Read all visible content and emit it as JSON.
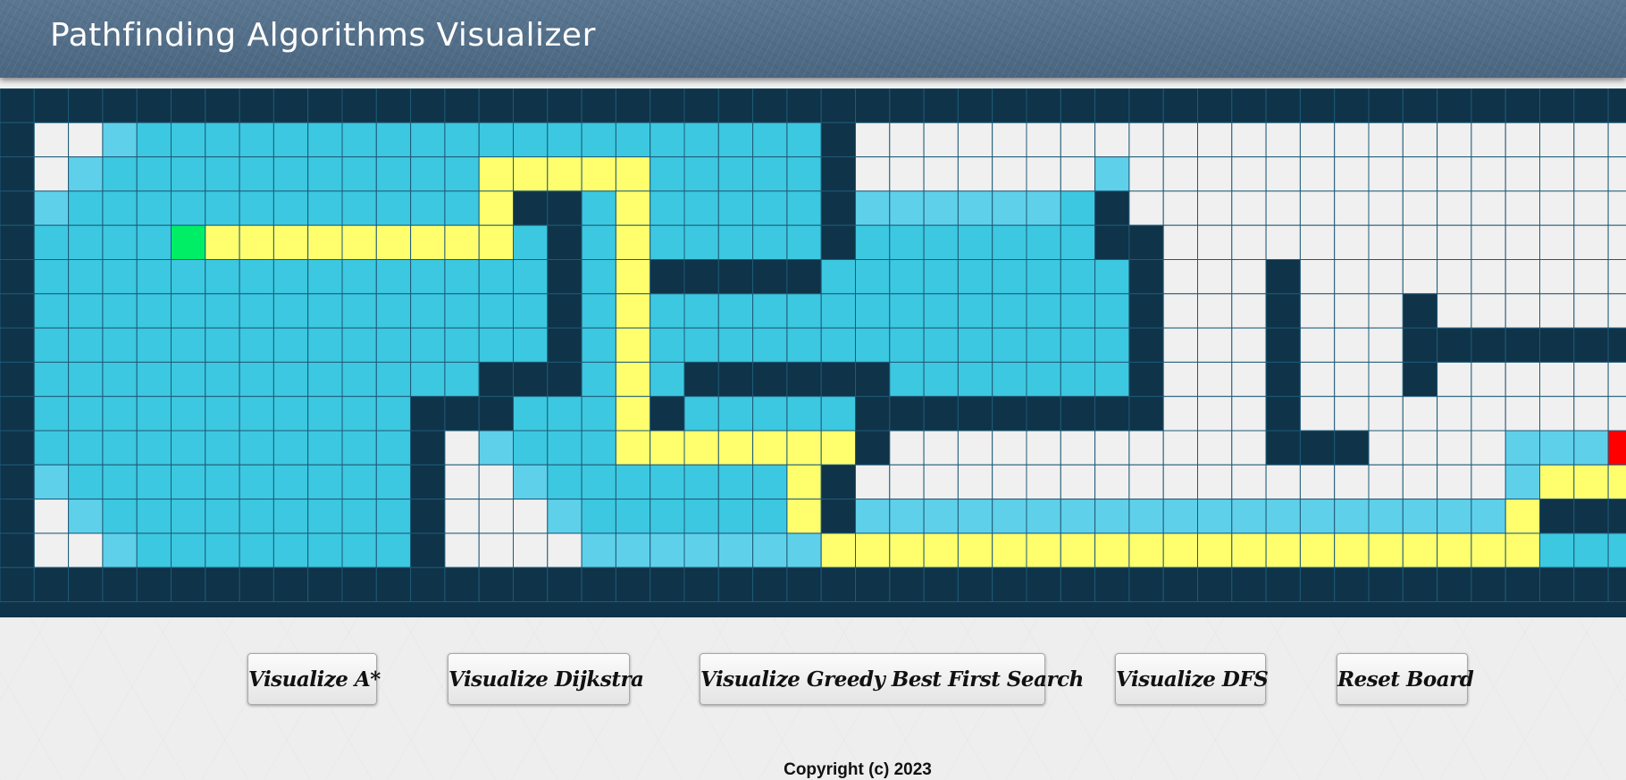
{
  "header": {
    "title": "Pathfinding Algorithms Visualizer"
  },
  "grid": {
    "rows": 15,
    "cols": 48,
    "colors": {
      "wall": "#0f3348",
      "empty": "#f0f0f0",
      "visited": "#3cc8e0",
      "visited_light": "#5fd0ea",
      "path": "#ffff6e",
      "start": "#00ee66",
      "end": "#ff0000",
      "grid_line": "#1e5a78"
    },
    "cells": [
      "WWWWWWWWWWWWWWWWWWWWWWWWWWWWWWWWWWWWWWWWWWWWWWWWWW",
      "W..LVVVVVVVVVVVVVVVVVVVVW.......................",
      "W.LVVVVVVVVVVVPPPPPVVVVVW.......L...............",
      "WLVVVVVVVVVVVVPWWVPVVVVVWLLLLLLVW................",
      "WVVVVSPPPPPPPPPVWVPVVVVVWVVVVVVVWW...............",
      "WVVVVVVVVVVVVVVVWVPWWWWWVVVVVVVVVW...W............",
      "WVVVVVVVVVVVVVVVWVPVVVVVVVVVVVVVVW...W...W........",
      "WVVVVVVVVVVVVVVVWVPVVVVVVVVVVVVVVW...W...WWWWWWWW",
      "WVVVVVVVVVVVVVWWWVPVWWWWWWVVVVVVVW...W...W......W",
      "WVVVVVVVVVVVWWWVVVPWVVVVVWWWWWWWWW...W...........W",
      "WVVVVVVVVVVVW.LVVVPPPPPPPW...........WWW....LLLE.W",
      "WLVVVVVVVVVVW..LVVVVVVVPW...................LPPPLW",
      "W.LVVVVVVVVVW...LVVVVVVPWLLLLLLLLLLLLLLLLLLLPWWWWW",
      "W..LVVVVVVVVW....LLLLLLLPPPPPPPPPPPPPPPPPPPPPVVVLW.",
      "WWWWWWWWWWWWWWWWWWWWWWWWWWWWWWWWWWWWWWWWWWWWWWWWWW"
    ]
  },
  "controls": {
    "buttons": [
      {
        "label": "Visualize A*"
      },
      {
        "label": "Visualize Dijkstra"
      },
      {
        "label": "Visualize Greedy Best First Search"
      },
      {
        "label": "Visualize DFS"
      },
      {
        "label": "Reset Board"
      }
    ]
  },
  "footer": {
    "copyright": "Copyright (c) 2023"
  }
}
